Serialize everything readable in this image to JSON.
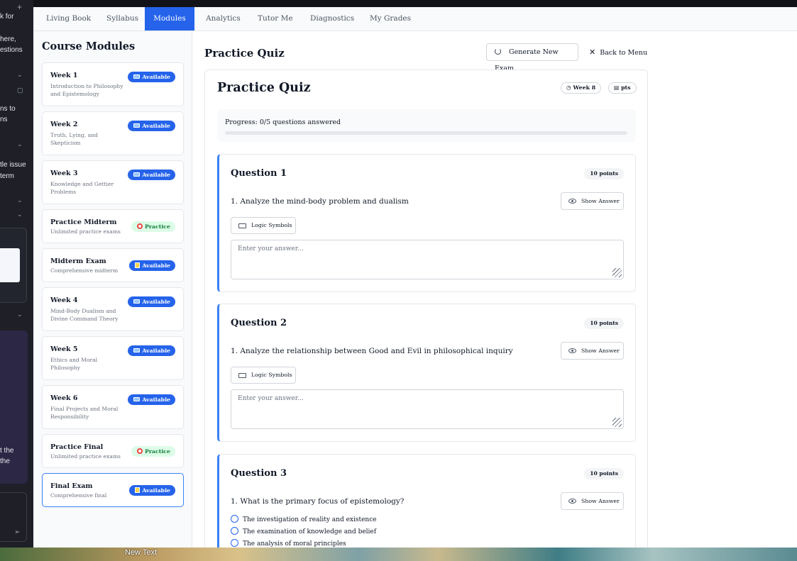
{
  "background_app": {
    "lines": [
      "k for",
      "here,",
      "estions",
      "ns to",
      "ns",
      "tle issue",
      "term",
      "t the",
      "the"
    ]
  },
  "desktop": {
    "label": "New Text"
  },
  "tabs": [
    "Living Book",
    "Syllabus",
    "Modules",
    "Analytics",
    "Tutor Me",
    "Diagnostics",
    "My Grades"
  ],
  "active_tab": "Modules",
  "sidebar": {
    "title": "Course Modules",
    "modules": [
      {
        "title": "Week 1",
        "subtitle": "Introduction to Philosophy and Epistemology",
        "badge": "Available",
        "icon": "book-icon"
      },
      {
        "title": "Week 2",
        "subtitle": "Truth, Lying, and Skepticism",
        "badge": "Available",
        "icon": "book-icon"
      },
      {
        "title": "Week 3",
        "subtitle": "Knowledge and Gettier Problems",
        "badge": "Available",
        "icon": "book-icon"
      },
      {
        "title": "Practice Midterm",
        "subtitle": "Unlimited practice exams",
        "badge": "Practice",
        "icon": "target-icon"
      },
      {
        "title": "Midterm Exam",
        "subtitle": "Comprehensive midterm",
        "badge": "Available",
        "icon": "note-icon"
      },
      {
        "title": "Week 4",
        "subtitle": "Mind-Body Dualism and Divine Command Theory",
        "badge": "Available",
        "icon": "book-icon"
      },
      {
        "title": "Week 5",
        "subtitle": "Ethics and Moral Philosophy",
        "badge": "Available",
        "icon": "book-icon"
      },
      {
        "title": "Week 6",
        "subtitle": "Final Projects and Moral Responsibility",
        "badge": "Available",
        "icon": "book-icon"
      },
      {
        "title": "Practice Final",
        "subtitle": "Unlimited practice exams",
        "badge": "Practice",
        "icon": "target-icon"
      },
      {
        "title": "Final Exam",
        "subtitle": "Comprehensive final",
        "badge": "Available",
        "icon": "note-icon"
      }
    ]
  },
  "main": {
    "page_title": "Practice Quiz",
    "generate_button": "Generate New Exam",
    "back_button": "Back to Menu",
    "quiz": {
      "title": "Practice Quiz",
      "week_pill": "Week 8",
      "pts_pill": "pts",
      "progress_text": "Progress: 0/5 questions answered",
      "progress_fraction": 0,
      "questions": [
        {
          "title": "Question 1",
          "points": "10 points",
          "prompt": "1. Analyze the mind-body problem and dualism",
          "show_answer": "Show Answer",
          "symbols": "Logic Symbols",
          "placeholder": "Enter your answer..."
        },
        {
          "title": "Question 2",
          "points": "10 points",
          "prompt": "1. Analyze the relationship between Good and Evil in philosophical inquiry",
          "show_answer": "Show Answer",
          "symbols": "Logic Symbols",
          "placeholder": "Enter your answer..."
        },
        {
          "title": "Question 3",
          "points": "10 points",
          "prompt": "1. What is the primary focus of epistemology?",
          "show_answer": "Show Answer",
          "options": [
            "The investigation of reality and existence",
            "The examination of knowledge and belief",
            "The analysis of moral principles"
          ]
        }
      ]
    }
  },
  "colors": {
    "accent": "#2563eb",
    "practice_bg": "#dcfce7",
    "practice_text": "#15803d"
  }
}
